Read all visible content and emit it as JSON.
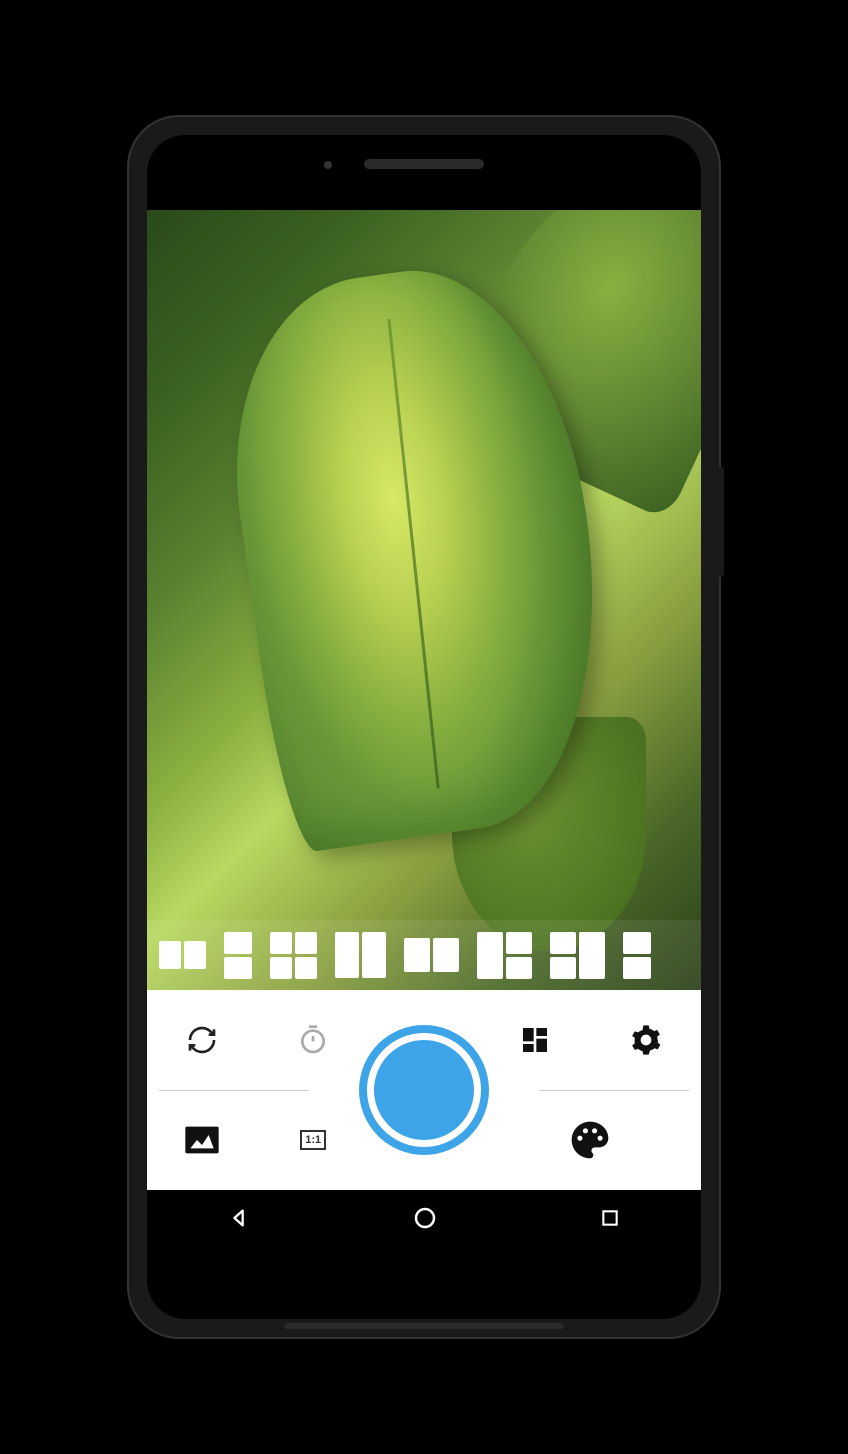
{
  "app": {
    "aspect_ratio_label": "1:1",
    "shutter_color": "#3ea4e8"
  },
  "layouts": [
    {
      "id": "2x1-square"
    },
    {
      "id": "1x2-vertical"
    },
    {
      "id": "2x2-grid"
    },
    {
      "id": "2x1-tall"
    },
    {
      "id": "2x1-wide"
    },
    {
      "id": "1-2-left"
    },
    {
      "id": "2-1-right"
    }
  ],
  "controls": {
    "row1": [
      "switch-camera",
      "timer",
      "collage-layout",
      "settings"
    ],
    "row2": [
      "gallery",
      "aspect-ratio",
      "color-palette"
    ]
  },
  "nav": [
    "back",
    "home",
    "recents"
  ]
}
